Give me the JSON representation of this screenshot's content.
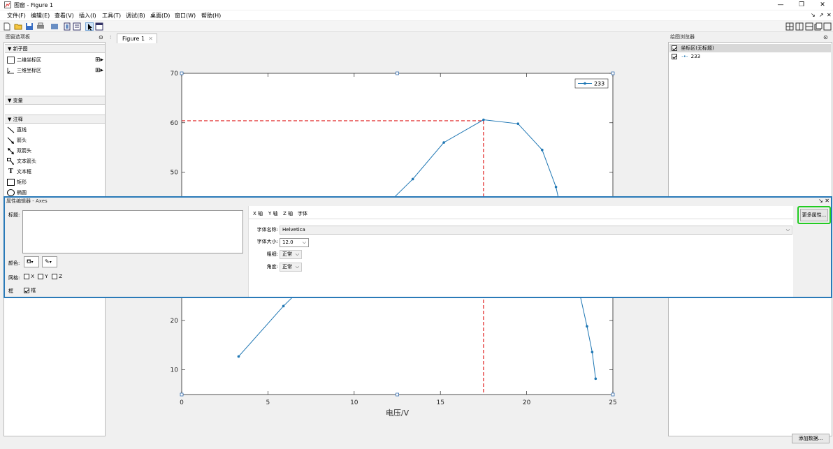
{
  "window": {
    "title": "图窗 - Figure 1",
    "colors": {
      "accent": "#2a7ab8",
      "highlight": "#22cc22"
    }
  },
  "menu": {
    "items": [
      "文件(F)",
      "编辑(E)",
      "查看(V)",
      "插入(I)",
      "工具(T)",
      "调试(B)",
      "桌面(D)",
      "窗口(W)",
      "帮助(H)"
    ]
  },
  "left_panel": {
    "title": "图窗选项板",
    "sections": {
      "new_subplot": "新子图",
      "variables": "变量",
      "annotations": "注释"
    },
    "subplot_items": [
      "二维坐标区",
      "三维坐标区"
    ],
    "annotation_items": [
      "直线",
      "箭头",
      "双箭头",
      "文本箭头",
      "文本框",
      "矩形",
      "椭圆"
    ]
  },
  "tabs": {
    "figure_tab": "Figure 1"
  },
  "right_panel": {
    "title": "绘图浏览器",
    "axes_item": "坐标区(无标题)",
    "series_item": "233",
    "add_data_button": "添加数据..."
  },
  "property_editor": {
    "title": "属性编辑器 - Axes",
    "title_label": "标题:",
    "color_label": "颜色:",
    "grid_label": "网格:",
    "grid_x": "X",
    "grid_y": "Y",
    "grid_z": "Z",
    "box_label": "框",
    "box_check_label": "框",
    "tabs": [
      "X 轴",
      "Y 轴",
      "Z 轴",
      "字体"
    ],
    "font_name_label": "字体名称:",
    "font_name_value": "Helvetica",
    "font_size_label": "字体大小:",
    "font_size_value": "12.0",
    "weight_label": "粗细:",
    "weight_value": "正常",
    "angle_label": "角度:",
    "angle_value": "正常",
    "more_props_button": "更多属性..."
  },
  "chart_data": {
    "type": "line",
    "xlabel": "电压/V",
    "ylabel": "",
    "title": "",
    "xlim": [
      0,
      25
    ],
    "ylim": [
      5,
      70
    ],
    "xticks": [
      0,
      5,
      10,
      15,
      20,
      25
    ],
    "yticks": [
      10,
      20,
      50,
      60,
      70
    ],
    "legend": {
      "placement": "top-right",
      "entries": [
        "233"
      ]
    },
    "series": [
      {
        "name": "233",
        "color": "#1f77b4",
        "x": [
          3.3,
          5.9,
          13.4,
          15.2,
          17.5,
          19.5,
          20.9,
          21.7,
          23.5,
          23.8,
          24.0
        ],
        "y": [
          12.7,
          22.9,
          48.6,
          56.0,
          60.6,
          59.8,
          54.5,
          47.0,
          18.8,
          13.6,
          8.2
        ]
      }
    ],
    "reference_lines": {
      "color": "#e02020",
      "style": "dashed",
      "x": 17.5,
      "y": 60.4
    }
  }
}
